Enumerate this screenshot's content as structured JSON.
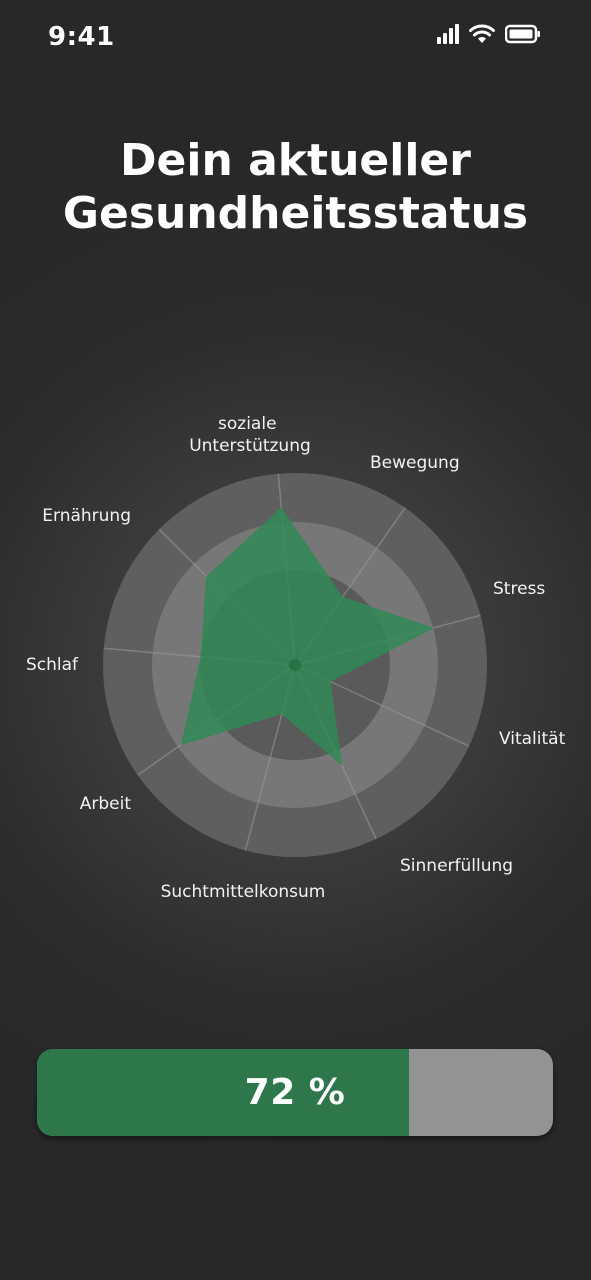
{
  "status_bar": {
    "time": "9:41",
    "icons": [
      "cellular-signal-icon",
      "wifi-icon",
      "battery-icon"
    ]
  },
  "header": {
    "title_line1": "Dein aktueller",
    "title_line2": "Gesundheitsstatus"
  },
  "chart_data": {
    "type": "radar",
    "axes": [
      "soziale Unterstützung",
      "Bewegung",
      "Stress",
      "Vitalität",
      "Sinnerfüllung",
      "Suchtmittelkonsum",
      "Arbeit",
      "Schlaf",
      "Ernährung"
    ],
    "values": [
      0.82,
      0.43,
      0.74,
      0.2,
      0.57,
      0.26,
      0.72,
      0.49,
      0.65
    ],
    "scale": [
      0,
      1
    ],
    "rings": 3,
    "colors": {
      "fill": "#2f8a55",
      "ring_outer": "#5f5f5f",
      "ring_mid": "#777777",
      "ring_inner": "#5a5a5a",
      "spoke": "#9a9a9a"
    }
  },
  "progress": {
    "value": 0.72,
    "label": "72 %",
    "fill_color": "#2d774b",
    "track_color": "#939393"
  }
}
